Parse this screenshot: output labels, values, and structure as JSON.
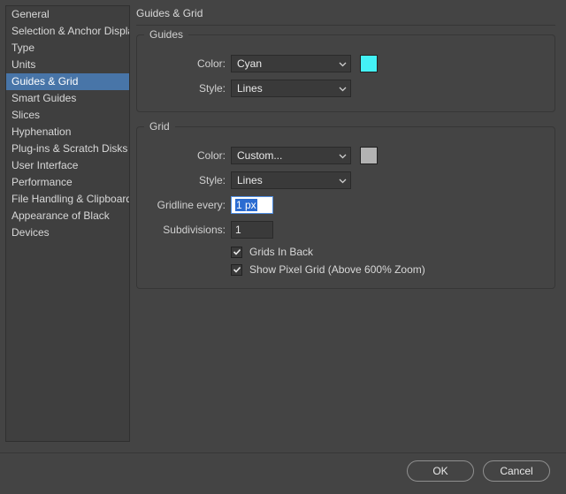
{
  "sidebar": {
    "items": [
      "General",
      "Selection & Anchor Display",
      "Type",
      "Units",
      "Guides & Grid",
      "Smart Guides",
      "Slices",
      "Hyphenation",
      "Plug-ins & Scratch Disks",
      "User Interface",
      "Performance",
      "File Handling & Clipboard",
      "Appearance of Black",
      "Devices"
    ],
    "selected_index": 4
  },
  "panel": {
    "title": "Guides & Grid",
    "guides": {
      "legend": "Guides",
      "color_label": "Color:",
      "color_value": "Cyan",
      "color_swatch": "#44f2f7",
      "style_label": "Style:",
      "style_value": "Lines"
    },
    "grid": {
      "legend": "Grid",
      "color_label": "Color:",
      "color_value": "Custom...",
      "color_swatch": "#b3b3b3",
      "style_label": "Style:",
      "style_value": "Lines",
      "gridline_label": "Gridline every:",
      "gridline_value": "1 px",
      "subdiv_label": "Subdivisions:",
      "subdiv_value": "1",
      "grids_in_back_label": "Grids In Back",
      "grids_in_back_checked": true,
      "show_pixel_grid_label": "Show Pixel Grid (Above 600% Zoom)",
      "show_pixel_grid_checked": true
    }
  },
  "footer": {
    "ok": "OK",
    "cancel": "Cancel"
  }
}
